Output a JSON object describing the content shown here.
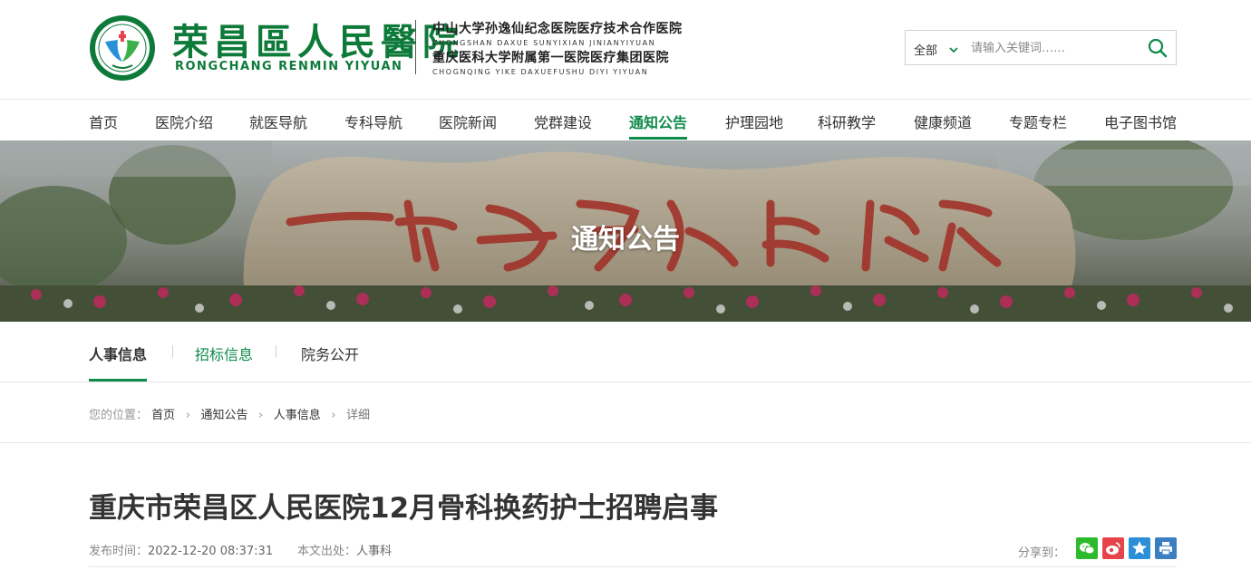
{
  "header": {
    "logo_title": "荣昌區人民醫院",
    "logo_subtitle": "RONGCHANG RENMIN YIYUAN",
    "affiliation_1_cn": "中山大学孙逸仙纪念医院医疗技术合作医院",
    "affiliation_1_en": "ZHONGSHAN DAXUE SUNYIXIAN JINIANYIYUAN",
    "affiliation_2_cn": "重庆医科大学附属第一医院医疗集团医院",
    "affiliation_2_en": "CHOGNQING YIKE DAXUEFUSHU DIYI YIYUAN"
  },
  "search": {
    "scope": "全部",
    "placeholder": "请输入关键词……"
  },
  "nav": {
    "items": [
      {
        "label": "首页"
      },
      {
        "label": "医院介绍"
      },
      {
        "label": "就医导航"
      },
      {
        "label": "专科导航"
      },
      {
        "label": "医院新闻"
      },
      {
        "label": "党群建设"
      },
      {
        "label": "通知公告"
      },
      {
        "label": "护理园地"
      },
      {
        "label": "科研教学"
      },
      {
        "label": "健康频道"
      },
      {
        "label": "专题专栏"
      },
      {
        "label": "电子图书馆"
      }
    ],
    "active": "通知公告"
  },
  "banner": {
    "title": "通知公告",
    "stone_inscription": "一切为了人民健康"
  },
  "subtabs": [
    {
      "label": "人事信息",
      "state": "active"
    },
    {
      "label": "招标信息",
      "state": "highlight"
    },
    {
      "label": "院务公开",
      "state": "normal"
    }
  ],
  "breadcrumb": {
    "prefix": "您的位置：",
    "items": [
      "首页",
      "通知公告",
      "人事信息"
    ],
    "current": "详细"
  },
  "article": {
    "title": "重庆市荣昌区人民医院12月骨科换药护士招聘启事",
    "publish_label": "发布时间：",
    "publish_time": "2022-12-20 08:37:31",
    "source_label": "本文出处：",
    "source": "人事科",
    "share_label": "分享到："
  },
  "colors": {
    "brand_green": "#0e8a4a",
    "logo_green": "#0e7a3a",
    "wechat": "#2dba2d",
    "weibo": "#e6434a",
    "qzone": "#2a8fd6",
    "print": "#3a7fc1"
  },
  "icons": [
    "search-icon",
    "chevron-down-icon",
    "wechat-icon",
    "weibo-icon",
    "qzone-star-icon",
    "print-icon"
  ]
}
